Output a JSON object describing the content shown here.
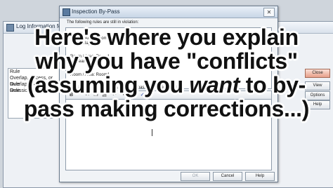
{
  "background_window": {
    "title": "Log Information for Ro",
    "rule_list": [
      "Rule",
      "Overlap, Excess, or Rule",
      "Overlap, Excess, or Rule",
      "Omissions"
    ],
    "buttons": {
      "close": "Close",
      "view": "View",
      "options": "Options",
      "help": "Help"
    }
  },
  "dialog": {
    "title": "Inspection By-Pass",
    "intro": "The following rules are still in violation:",
    "violations": [
      {
        "room": "Room / Area:  Room1",
        "detail": "Overlap"
      },
      {
        "room": "Room / Area:  Room1",
        "detail": "Seal & Paint"
      },
      {
        "room": "Room / Area:  Room1",
        "detail": ""
      }
    ],
    "reason_caption": "Please explain the reason you are by-passing the violations:",
    "toolbar_icons": [
      "bold-icon",
      "cut-icon",
      "copy-icon",
      "paste-icon",
      "undo-icon",
      "redo-icon",
      "find-icon",
      "spell-check-icon"
    ],
    "buttons": {
      "ok": "OK",
      "cancel": "Cancel",
      "help": "Help"
    }
  },
  "overlay": {
    "line1": "Here's where you explain",
    "line2": "why you have \"conflicts\"",
    "line3_pre": "(assuming you ",
    "line3_em": "want",
    "line3_post": " to by-",
    "line4": "pass making corrections...)"
  }
}
